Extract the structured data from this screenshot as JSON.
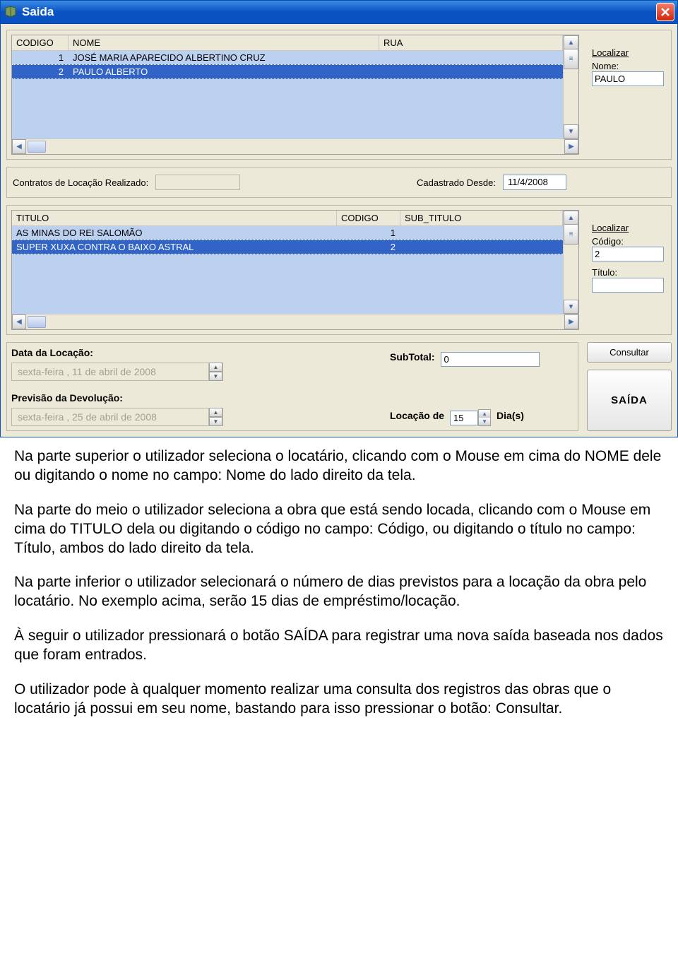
{
  "window": {
    "title": "Saida"
  },
  "grid1": {
    "columns": {
      "codigo": "CODIGO",
      "nome": "NOME",
      "rua": "RUA"
    },
    "rows": [
      {
        "codigo": "1",
        "nome": "JOSÉ MARIA APARECIDO ALBERTINO CRUZ"
      },
      {
        "codigo": "2",
        "nome": "PAULO ALBERTO"
      }
    ],
    "side": {
      "localizar": "Localizar",
      "nome_label": "Nome:",
      "nome_value": "PAULO"
    }
  },
  "midline": {
    "contratos_label": "Contratos de Locação Realizado:",
    "contratos_value": "",
    "cadastrado_label": "Cadastrado Desde:",
    "cadastrado_value": "11/4/2008"
  },
  "grid2": {
    "columns": {
      "titulo": "TITULO",
      "codigo": "CODIGO",
      "subtitulo": "SUB_TITULO"
    },
    "rows": [
      {
        "titulo": "AS MINAS DO REI SALOMÃO",
        "codigo": "1"
      },
      {
        "titulo": "SUPER XUXA CONTRA O BAIXO ASTRAL",
        "codigo": "2"
      }
    ],
    "side": {
      "localizar": "Localizar",
      "codigo_label": "Código:",
      "codigo_value": "2",
      "titulo_label": "Título:",
      "titulo_value": ""
    }
  },
  "bottom": {
    "data_locacao_label": "Data da Locação:",
    "data_locacao_value": "sexta-feira  , 11 de     abril     de 2008",
    "previsao_label": "Previsão da Devolução:",
    "previsao_value": "sexta-feira  , 25 de     abril     de 2008",
    "subtotal_label": "SubTotal:",
    "subtotal_value": "0",
    "locacao_de_label": "Locação de",
    "locacao_dias": "15",
    "dias_label": "Dia(s)",
    "consultar": "Consultar",
    "saida": "SAÍDA"
  },
  "doc": {
    "p1": "Na parte superior o utilizador seleciona o locatário, clicando com o Mouse em cima do NOME dele ou digitando o nome no campo: Nome do lado direito da tela.",
    "p2": "Na parte do meio o utilizador seleciona a obra que está sendo locada, clicando com o Mouse em cima do TITULO dela ou digitando o código no campo: Código, ou digitando o título no campo: Título, ambos do lado direito da tela.",
    "p3": "Na parte inferior o utilizador selecionará o número de dias previstos para a locação da obra pelo locatário. No exemplo acima, serão 15 dias de empréstimo/locação.",
    "p4": "À seguir o utilizador pressionará o botão SAÍDA para registrar uma nova saída baseada nos dados que foram entrados.",
    "p5": "O utilizador pode à qualquer momento realizar uma consulta dos registros das obras que o locatário já possui em seu nome, bastando para isso pressionar o botão: Consultar."
  }
}
